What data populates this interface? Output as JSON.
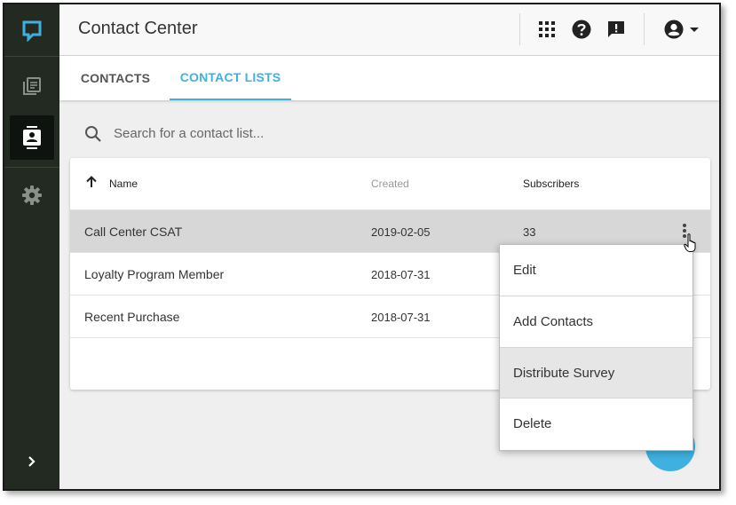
{
  "header": {
    "app_title": "Contact Center",
    "icons": [
      "apps-grid-icon",
      "help-icon",
      "feedback-icon",
      "account-icon",
      "caret-down-icon"
    ]
  },
  "sidebar": {
    "items": [
      {
        "icon": "logo-icon",
        "active": false
      },
      {
        "icon": "library-icon",
        "active": false
      },
      {
        "icon": "contacts-icon",
        "active": true
      },
      {
        "icon": "gear-icon",
        "active": false
      },
      {
        "icon": "chevron-right-icon",
        "active": false
      }
    ]
  },
  "tabs": [
    {
      "label": "CONTACTS",
      "active": false
    },
    {
      "label": "CONTACT LISTS",
      "active": true
    }
  ],
  "search": {
    "placeholder": "Search for a contact list..."
  },
  "table": {
    "headers": {
      "name": "Name",
      "created": "Created",
      "subscribers": "Subscribers"
    },
    "sort": "ascending",
    "rows": [
      {
        "name": "Call Center CSAT",
        "created": "2019-02-05",
        "subscribers": "33"
      },
      {
        "name": "Loyalty Program Member",
        "created": "2018-07-31",
        "subscribers": ""
      },
      {
        "name": "Recent Purchase",
        "created": "2018-07-31",
        "subscribers": ""
      }
    ]
  },
  "menu": {
    "items": [
      "Edit",
      "Add Contacts",
      "Distribute Survey",
      "Delete"
    ],
    "highlighted": "Distribute Survey"
  },
  "colors": {
    "accent": "#3fb1e0",
    "sidebar_bg": "#232a22",
    "logo": "#3fb1e0"
  }
}
